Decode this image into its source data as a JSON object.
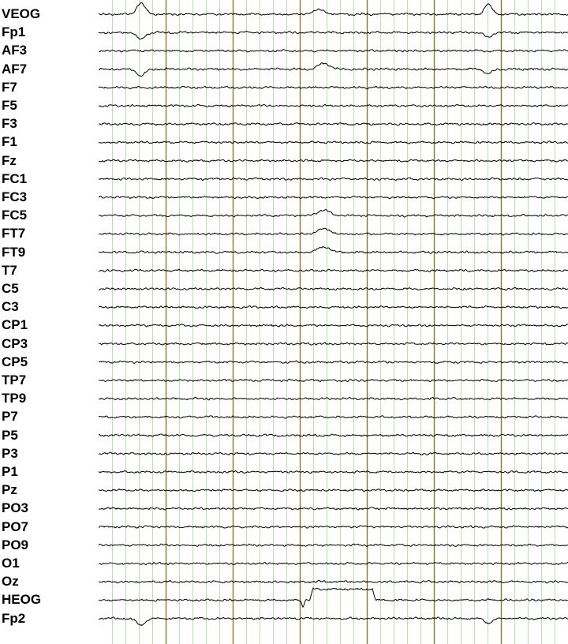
{
  "chart_data": {
    "type": "line",
    "channels": [
      "VEOG",
      "Fp1",
      "AF3",
      "AF7",
      "F7",
      "F5",
      "F3",
      "F1",
      "Fz",
      "FC1",
      "FC3",
      "FC5",
      "FT7",
      "FT9",
      "T7",
      "C5",
      "C3",
      "CP1",
      "CP3",
      "CP5",
      "TP7",
      "TP9",
      "P7",
      "P5",
      "P3",
      "P1",
      "Pz",
      "PO3",
      "PO7",
      "PO9",
      "O1",
      "Oz",
      "HEOG",
      "Fp2"
    ],
    "grid": true,
    "major_divisions": 7,
    "minor_per_major": 5,
    "events": [
      {
        "channels": [
          "VEOG"
        ],
        "center": 0.09,
        "width": 0.035,
        "amp": -1.0
      },
      {
        "channels": [
          "VEOG"
        ],
        "center": 0.83,
        "width": 0.03,
        "amp": -0.9
      },
      {
        "channels": [
          "VEOG"
        ],
        "center": 0.47,
        "width": 0.05,
        "amp": -0.4
      },
      {
        "channels": [
          "Fp1",
          "AF7",
          "Fp2"
        ],
        "center": 0.09,
        "width": 0.035,
        "amp": 0.6
      },
      {
        "channels": [
          "Fp1",
          "AF7",
          "Fp2"
        ],
        "center": 0.83,
        "width": 0.03,
        "amp": 0.45
      },
      {
        "channels": [
          "AF7",
          "FT9",
          "FT7",
          "FC5"
        ],
        "center": 0.48,
        "width": 0.05,
        "amp": -0.5
      },
      {
        "channels": [
          "HEOG"
        ],
        "center": 0.52,
        "width": 0.14,
        "amp": -1.0,
        "shape": "box"
      },
      {
        "channels": [
          "HEOG"
        ],
        "center": 0.435,
        "width": 0.01,
        "amp": 0.6
      }
    ],
    "colors": {
      "trace": "#000000",
      "major_grid": "#8b7a2a",
      "minor_grid": "#b8e0b0"
    }
  }
}
